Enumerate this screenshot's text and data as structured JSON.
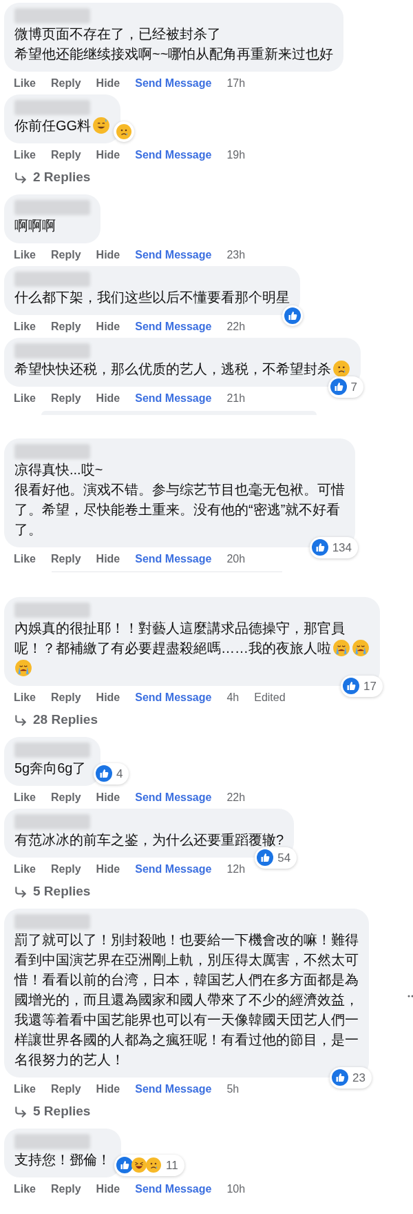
{
  "comments": [
    {
      "lines": [
        {
          "text": "微博页面不存在了，已经被封杀了"
        },
        {
          "text": "希望他还能继续接戏啊~~哪怕从配角再重新来过也好"
        }
      ],
      "actions": [
        "Like",
        "Reply",
        "Hide",
        "Send Message"
      ],
      "time": "17h"
    },
    {
      "lines": [
        {
          "text": "你前任GG料",
          "emojis": [
            {
              "kind": "sweat-smile"
            }
          ]
        }
      ],
      "reactions": {
        "icons": [
          {
            "kind": "sad"
          }
        ]
      },
      "actions": [
        "Like",
        "Reply",
        "Hide",
        "Send Message"
      ],
      "time": "19h",
      "replies": "2 Replies"
    },
    {
      "lines": [
        {
          "text": "啊啊啊"
        }
      ],
      "actions": [
        "Like",
        "Reply",
        "Hide",
        "Send Message"
      ],
      "time": "23h"
    },
    {
      "lines": [
        {
          "text": "什么都下架，我们这些以后不懂要看那个明星"
        }
      ],
      "reactions": {
        "icons": [
          {
            "kind": "like"
          }
        ]
      },
      "actions": [
        "Like",
        "Reply",
        "Hide",
        "Send Message"
      ],
      "time": "22h"
    },
    {
      "lines": [
        {
          "text": "希望快快还税，那么优质的艺人，逃税，不希望封杀",
          "emojis": [
            {
              "kind": "sad"
            }
          ]
        }
      ],
      "reactions": {
        "icons": [
          {
            "kind": "like"
          }
        ],
        "count": "7"
      },
      "actions": [
        "Like",
        "Reply",
        "Hide",
        "Send Message"
      ],
      "time": "21h",
      "partial_next": true
    },
    {
      "lines": [
        {
          "text": "凉得真快...哎~"
        },
        {
          "text": "很看好他。演戏不错。参与综艺节目也毫无包袱。可惜"
        },
        {
          "text": "了。希望，尽快能卷土重来。没有他的“密逃”就不好看"
        },
        {
          "text": "了。"
        }
      ],
      "reactions": {
        "icons": [
          {
            "kind": "like"
          }
        ],
        "count": "134"
      },
      "actions": [
        "Like",
        "Reply",
        "Hide",
        "Send Message"
      ],
      "time": "20h",
      "divider": true
    },
    {
      "lines": [
        {
          "text": "內娛真的很扯耶！！對藝人這麼講求品德操守，那官員"
        },
        {
          "text": "呢！？都補繳了有必要趕盡殺絕嗎……我的夜旅人啦",
          "emojis": [
            {
              "kind": "cry"
            },
            {
              "kind": "cry"
            }
          ]
        },
        {
          "emojis": [
            {
              "kind": "cry"
            }
          ]
        }
      ],
      "reactions": {
        "icons": [
          {
            "kind": "like"
          }
        ],
        "count": "17"
      },
      "actions": [
        "Like",
        "Reply",
        "Hide",
        "Send Message"
      ],
      "time": "4h",
      "edited": "Edited",
      "replies": "28 Replies"
    },
    {
      "lines": [
        {
          "text": "5g奔向6g了"
        }
      ],
      "reactions": {
        "icons": [
          {
            "kind": "like"
          }
        ],
        "count": "4"
      },
      "actions": [
        "Like",
        "Reply",
        "Hide",
        "Send Message"
      ],
      "time": "22h"
    },
    {
      "lines": [
        {
          "text": "有范冰冰的前车之鉴，为什么还要重蹈覆辙?"
        }
      ],
      "reactions": {
        "icons": [
          {
            "kind": "like"
          }
        ],
        "count": "54"
      },
      "actions": [
        "Like",
        "Reply",
        "Hide",
        "Send Message"
      ],
      "time": "12h",
      "replies": "5 Replies"
    },
    {
      "lines": [
        {
          "text": "罰了就可以了！別封殺吔！也要給一下機會改的嘛！難得"
        },
        {
          "text": "看到中国演艺界在亞洲剛上軌，別压得太厲害，不然太可"
        },
        {
          "text": "惜！看看以前的台湾，日本，韓国艺人們在多方面都是為"
        },
        {
          "text": "國增光的，而且還為國家和國人帶來了不少的經濟效益，"
        },
        {
          "text": "我還等着看中国艺能界也可以有一天像韓國天団艺人們一"
        },
        {
          "text": "样讓世界各國的人都為之瘋狂呢！有看过他的節目，是一"
        },
        {
          "text": "名很努力的艺人！"
        }
      ],
      "reactions": {
        "icons": [
          {
            "kind": "like"
          }
        ],
        "count": "23"
      },
      "actions": [
        "Like",
        "Reply",
        "Hide",
        "Send Message"
      ],
      "time": "5h",
      "replies": "5 Replies",
      "more_menu": true
    },
    {
      "lines": [
        {
          "text": "支持您！鄧倫！"
        }
      ],
      "reactions": {
        "icons": [
          {
            "kind": "like"
          },
          {
            "kind": "laugh"
          },
          {
            "kind": "sad"
          }
        ],
        "count": "11"
      },
      "actions": [
        "Like",
        "Reply",
        "Hide",
        "Send Message"
      ],
      "time": "10h"
    }
  ]
}
